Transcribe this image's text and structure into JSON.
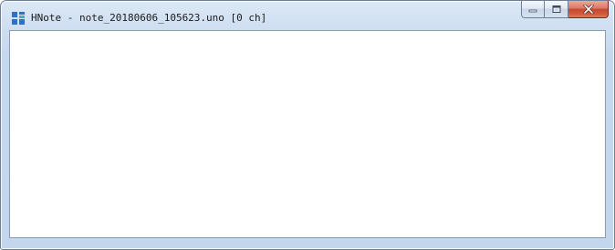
{
  "window": {
    "title": "HNote - note_20180606_105623.uno [0 ch]",
    "app_icon": "hnote-app-icon",
    "accent_color": "#2f6fc9"
  },
  "caption_buttons": {
    "minimize_icon": "minimize-icon",
    "maximize_icon": "maximize-icon",
    "close_icon": "close-icon"
  },
  "editor": {
    "content": "",
    "placeholder": ""
  }
}
